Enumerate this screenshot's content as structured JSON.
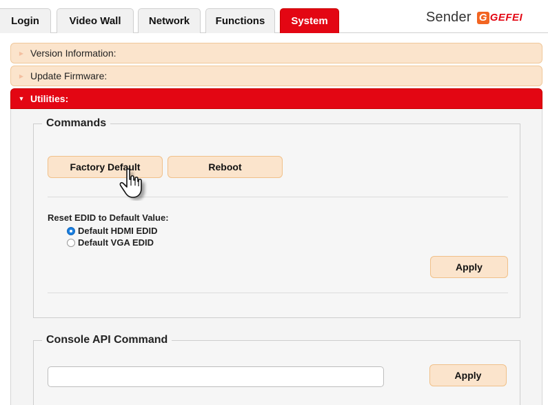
{
  "tabs": [
    {
      "label": "Login",
      "active": false
    },
    {
      "label": "Video Wall",
      "active": false
    },
    {
      "label": "Network",
      "active": false
    },
    {
      "label": "Functions",
      "active": false
    },
    {
      "label": "System",
      "active": true
    }
  ],
  "brand": {
    "label": "Sender",
    "logo_mark": "G",
    "logo_text": "GEFEI"
  },
  "sections": {
    "version": {
      "label": "Version Information:",
      "expanded": false,
      "icon": "triangle-right-icon"
    },
    "firmware": {
      "label": "Update Firmware:",
      "expanded": false,
      "icon": "triangle-right-icon"
    },
    "utilities": {
      "label": "Utilities:",
      "expanded": true,
      "icon": "triangle-down-icon"
    }
  },
  "commands": {
    "legend": "Commands",
    "factory_default_label": "Factory Default",
    "reboot_label": "Reboot",
    "edid": {
      "title": "Reset EDID to Default Value:",
      "options": [
        {
          "label": "Default HDMI EDID",
          "selected": true
        },
        {
          "label": "Default VGA EDID",
          "selected": false
        }
      ],
      "apply_label": "Apply"
    }
  },
  "console": {
    "legend": "Console API Command",
    "input_value": "",
    "apply_label": "Apply"
  },
  "colors": {
    "accent_red": "#e30613",
    "section_bg": "#fbe4cc",
    "button_bg": "#fbe4cc",
    "radio_selected": "#1a7fe0",
    "brand_orange": "#f26522"
  },
  "cursor": {
    "icon": "hand-pointer-icon",
    "hovering": "factory-default-button"
  }
}
